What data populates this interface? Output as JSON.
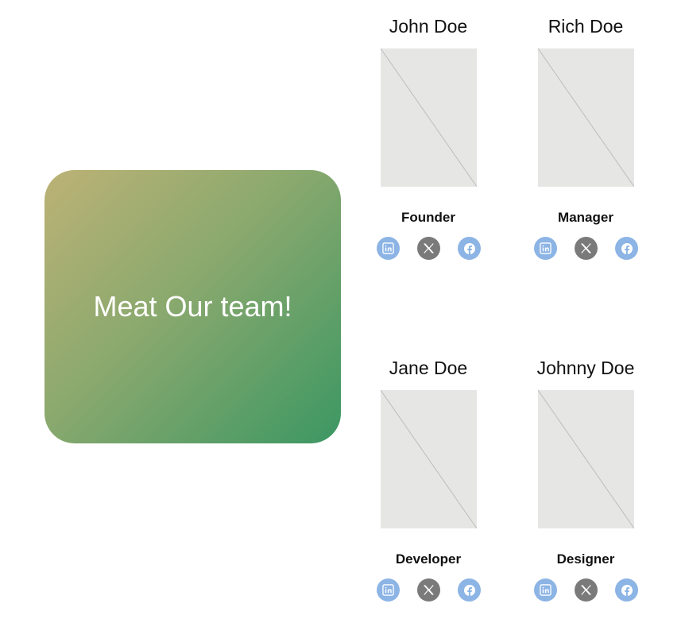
{
  "hero": {
    "title": "Meat Our team!"
  },
  "colors": {
    "gradient_start": "#bdb276",
    "gradient_end": "#3c9763",
    "linkedin_bg": "#8cb4e5",
    "x_bg": "#7a7a7a",
    "facebook_bg": "#8cb4e5",
    "photo_placeholder": "#e6e6e5"
  },
  "team": [
    {
      "name": "John Doe",
      "role": "Founder"
    },
    {
      "name": "Rich Doe",
      "role": "Manager"
    },
    {
      "name": "Jane Doe",
      "role": "Developer"
    },
    {
      "name": "Johnny Doe",
      "role": "Designer"
    }
  ],
  "social_icons": [
    "linkedin-icon",
    "x-icon",
    "facebook-icon"
  ]
}
